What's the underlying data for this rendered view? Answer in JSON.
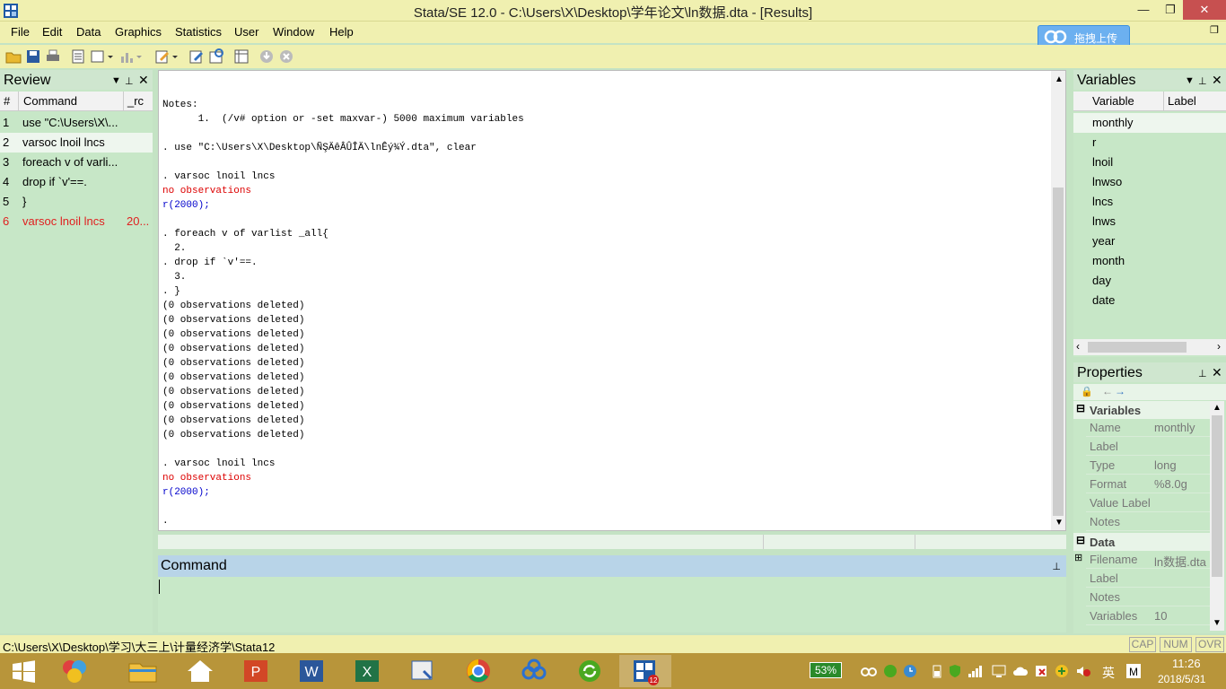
{
  "window": {
    "title": "Stata/SE 12.0 - C:\\Users\\X\\Desktop\\学年论文\\ln数据.dta - [Results]",
    "minimize": "—",
    "restore": "❐",
    "close": "✕",
    "mdi_restore": "❐"
  },
  "menu": [
    "File",
    "Edit",
    "Data",
    "Graphics",
    "Statistics",
    "User",
    "Window",
    "Help"
  ],
  "baidu_button": "拖拽上传",
  "review": {
    "title": "Review",
    "col_num": "#",
    "col_command": "Command",
    "col_rc": "_rc",
    "rows": [
      {
        "num": "1",
        "command": "use \"C:\\Users\\X\\...",
        "rc": ""
      },
      {
        "num": "2",
        "command": "varsoc lnoil lncs",
        "rc": ""
      },
      {
        "num": "3",
        "command": "foreach v of varli...",
        "rc": ""
      },
      {
        "num": "4",
        "command": "drop if `v'==.",
        "rc": ""
      },
      {
        "num": "5",
        "command": "}",
        "rc": ""
      },
      {
        "num": "6",
        "command": "varsoc lnoil lncs",
        "rc": "20..."
      }
    ]
  },
  "results": {
    "lines": [
      {
        "text": "Notes:",
        "color": "#000000"
      },
      {
        "text": "      1.  (/v# option or -set maxvar-) 5000 maximum variables",
        "color": "#000000"
      },
      {
        "text": "",
        "color": "#000000"
      },
      {
        "text": ". use \"C:\\Users\\X\\Desktop\\ÑŞÄêÂÛÎÄ\\lnÊý¾Ý.dta\", clear",
        "color": "#000000"
      },
      {
        "text": "",
        "color": "#000000"
      },
      {
        "text": ". varsoc lnoil lncs",
        "color": "#000000"
      },
      {
        "text": "no observations",
        "color": "#dd0000"
      },
      {
        "text": "r(2000);",
        "color": "#0000cc"
      },
      {
        "text": "",
        "color": "#000000"
      },
      {
        "text": ". foreach v of varlist _all{",
        "color": "#000000"
      },
      {
        "text": "  2.",
        "color": "#000000"
      },
      {
        "text": ". drop if `v'==.",
        "color": "#000000"
      },
      {
        "text": "  3.",
        "color": "#000000"
      },
      {
        "text": ". }",
        "color": "#000000"
      },
      {
        "text": "(0 observations deleted)",
        "color": "#000000"
      },
      {
        "text": "(0 observations deleted)",
        "color": "#000000"
      },
      {
        "text": "(0 observations deleted)",
        "color": "#000000"
      },
      {
        "text": "(0 observations deleted)",
        "color": "#000000"
      },
      {
        "text": "(0 observations deleted)",
        "color": "#000000"
      },
      {
        "text": "(0 observations deleted)",
        "color": "#000000"
      },
      {
        "text": "(0 observations deleted)",
        "color": "#000000"
      },
      {
        "text": "(0 observations deleted)",
        "color": "#000000"
      },
      {
        "text": "(0 observations deleted)",
        "color": "#000000"
      },
      {
        "text": "(0 observations deleted)",
        "color": "#000000"
      },
      {
        "text": "",
        "color": "#000000"
      },
      {
        "text": ". varsoc lnoil lncs",
        "color": "#000000"
      },
      {
        "text": "no observations",
        "color": "#dd0000"
      },
      {
        "text": "r(2000);",
        "color": "#0000cc"
      },
      {
        "text": "",
        "color": "#000000"
      },
      {
        "text": ".",
        "color": "#000000"
      }
    ]
  },
  "command": {
    "title": "Command",
    "value": ""
  },
  "variables": {
    "title": "Variables",
    "col_variable": "Variable",
    "col_label": "Label",
    "items": [
      "monthly",
      "r",
      "lnoil",
      "lnwso",
      "lncs",
      "lnws",
      "year",
      "month",
      "day",
      "date"
    ]
  },
  "properties": {
    "title": "Properties",
    "section_variables": "Variables",
    "variables_rows": [
      {
        "key": "Name",
        "value": "monthly"
      },
      {
        "key": "Label",
        "value": ""
      },
      {
        "key": "Type",
        "value": "long"
      },
      {
        "key": "Format",
        "value": "%8.0g"
      },
      {
        "key": "Value Label",
        "value": ""
      },
      {
        "key": "Notes",
        "value": ""
      }
    ],
    "section_data": "Data",
    "data_rows": [
      {
        "key": "Filename",
        "value": "ln数据.dta"
      },
      {
        "key": "Label",
        "value": ""
      },
      {
        "key": "Notes",
        "value": ""
      },
      {
        "key": "Variables",
        "value": "10"
      }
    ]
  },
  "status": {
    "path": "C:\\Users\\X\\Desktop\\学习\\大三上\\计量经济学\\Stata12",
    "cap": "CAP",
    "num": "NUM",
    "ovr": "OVR"
  },
  "taskbar": {
    "battery": "53%",
    "ime": "英",
    "time": "11:26",
    "date": "2018/5/31"
  }
}
